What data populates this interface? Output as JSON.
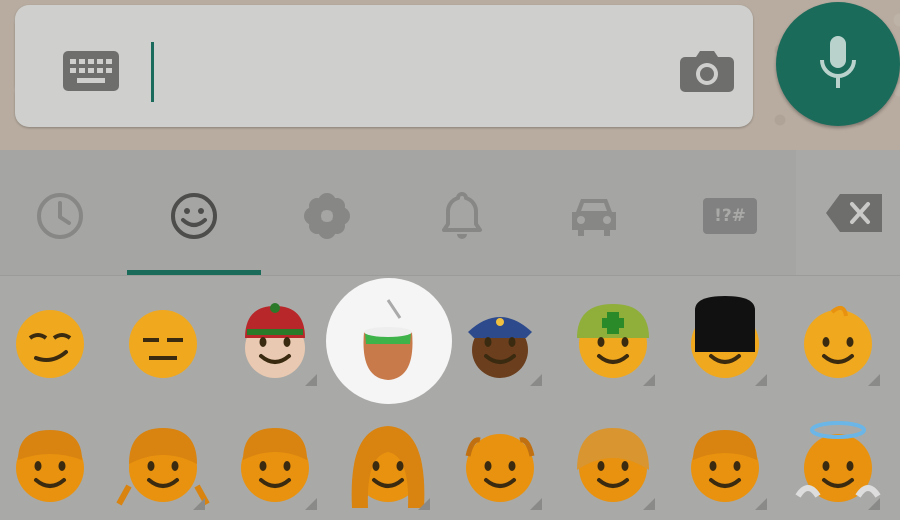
{
  "input": {
    "keyboard_icon": "keyboard-icon",
    "camera_icon": "camera-icon",
    "mic_icon": "microphone-icon",
    "text_value": ""
  },
  "tabs": [
    {
      "name": "recent",
      "icon": "clock-icon"
    },
    {
      "name": "smileys",
      "icon": "smiley-icon",
      "selected": true
    },
    {
      "name": "objects",
      "icon": "flower-icon"
    },
    {
      "name": "nature",
      "icon": "bell-icon"
    },
    {
      "name": "places",
      "icon": "car-icon"
    },
    {
      "name": "symbols",
      "label": "!?#"
    }
  ],
  "backspace_icon": "backspace-icon",
  "colors": {
    "accent": "#1b6b5b",
    "emoji_yellow": "#f0a81e",
    "emoji_orange": "#e8920f"
  },
  "emoji_rows": [
    [
      "smirking-face",
      "expressionless-face",
      "man-with-gua-pi-mao",
      "mate-drink",
      "police-officer",
      "helmet-worker",
      "guardsman",
      "baby"
    ],
    [
      "boy",
      "girl",
      "man",
      "woman",
      "older-man",
      "older-woman",
      "man-2",
      "baby-angel"
    ]
  ],
  "highlighted_emoji": "mate-drink"
}
